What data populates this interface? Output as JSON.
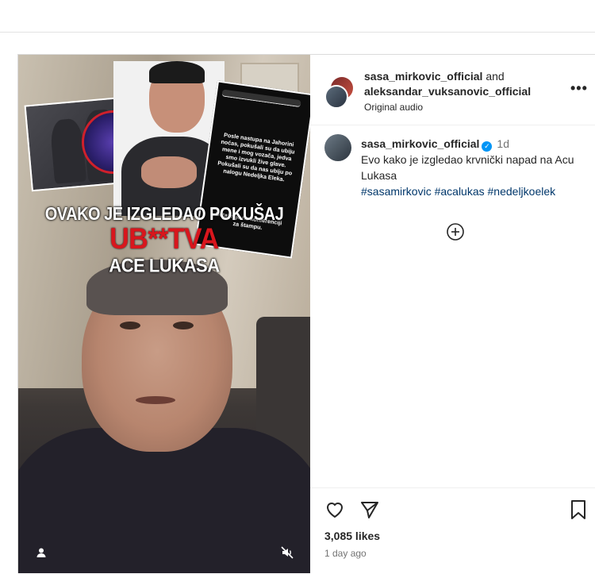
{
  "post": {
    "media": {
      "headline_line1": "OVAKO JE IZGLEDAO POKUŠAJ",
      "headline_line2": "UB**TVA",
      "headline_line3": "ACE LUKASA",
      "story_text": "Posle nastupa na Jahorini noćas, pokušali su da ubiju mene i mog vozača, jedva smo izvukli žive glave. Pokušali su da nas ubiju po nalogu Nedeljka Eleka.",
      "story_text2": "Detaljnije na konferenciji za štampu.",
      "user_icon": "user-tag-icon",
      "mute_icon": "speaker-muted-icon"
    },
    "header": {
      "user1": "sasa_mirkovic_official",
      "joiner": "and",
      "user2": "aleksandar_vuksanovic_official",
      "audio": "Original audio",
      "more_label": "•••"
    },
    "caption": {
      "username": "sasa_mirkovic_official",
      "verified": "✓",
      "time": "1d",
      "text": "Evo kako je izgledao krvnički napad na Acu Lukasa",
      "hashtags": "#sasamirkovic #acalukas #nedeljkoelek"
    },
    "load_more_icon": "plus-circle-icon",
    "likes": "3,085 likes",
    "date": "1 day ago",
    "colors": {
      "link": "#00376b",
      "verified": "#0095f6",
      "headline_red": "#d8161d"
    }
  }
}
